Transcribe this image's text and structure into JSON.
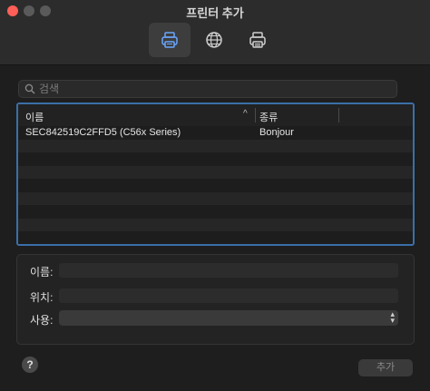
{
  "window": {
    "title": "프린터 추가"
  },
  "toolbar": {
    "items": [
      {
        "icon": "printer-icon",
        "active": true
      },
      {
        "icon": "globe-icon",
        "active": false
      },
      {
        "icon": "windows-printer-icon",
        "active": false
      }
    ]
  },
  "search": {
    "placeholder": "검색",
    "value": ""
  },
  "table": {
    "columns": [
      "이름",
      "종류"
    ],
    "sort_indicator": "^",
    "rows": [
      {
        "name": "SEC842519C2FFD5 (C56x Series)",
        "type": "Bonjour"
      }
    ]
  },
  "details": {
    "name_label": "이름:",
    "location_label": "위치:",
    "use_label": "사용:",
    "name_value": "",
    "location_value": "",
    "use_value": ""
  },
  "footer": {
    "help_label": "?",
    "add_label": "추가"
  },
  "colors": {
    "accent": "#3b6fa8",
    "close": "#ff5f57"
  }
}
